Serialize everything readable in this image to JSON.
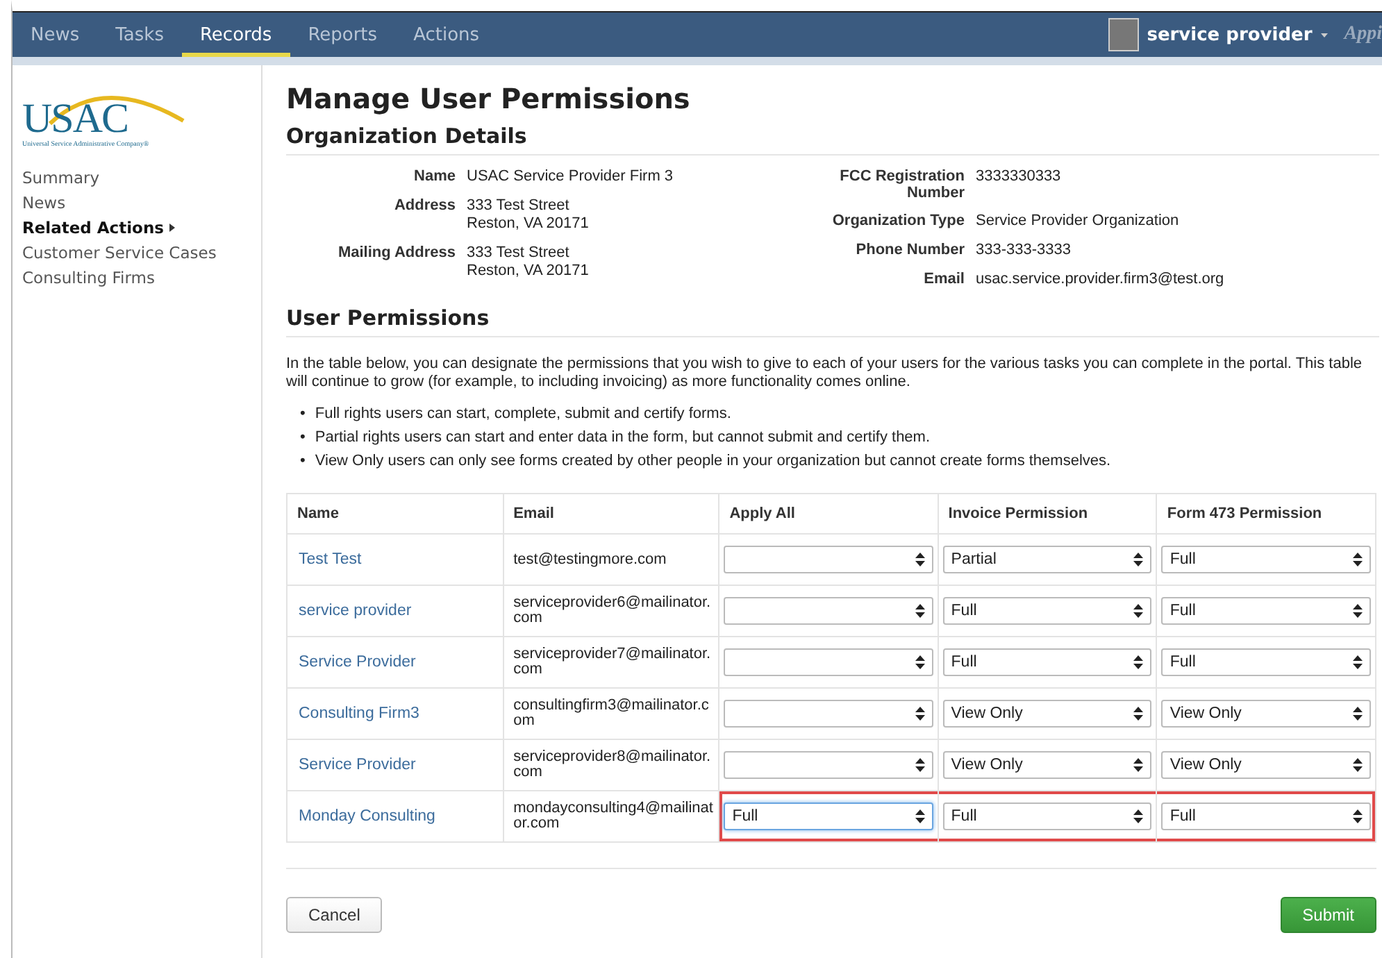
{
  "nav": {
    "tabs": [
      {
        "label": "News",
        "selected": false
      },
      {
        "label": "Tasks",
        "selected": false
      },
      {
        "label": "Records",
        "selected": true
      },
      {
        "label": "Reports",
        "selected": false
      },
      {
        "label": "Actions",
        "selected": false
      }
    ],
    "user": "service provider",
    "brand": "Appi"
  },
  "sidebar": {
    "logo": {
      "text": "USAC",
      "tagline": "Universal Service Administrative Company®"
    },
    "items": [
      {
        "label": "Summary",
        "selected": false,
        "expandable": false
      },
      {
        "label": "News",
        "selected": false,
        "expandable": false
      },
      {
        "label": "Related Actions",
        "selected": true,
        "expandable": true
      },
      {
        "label": "Customer Service Cases",
        "selected": false,
        "expandable": false
      },
      {
        "label": "Consulting Firms",
        "selected": false,
        "expandable": false
      }
    ]
  },
  "page_title": "Manage User Permissions",
  "org_details": {
    "heading": "Organization Details",
    "left": [
      {
        "label": "Name",
        "lines": [
          "USAC Service Provider Firm 3"
        ]
      },
      {
        "label": "Address",
        "lines": [
          "333 Test Street",
          "Reston, VA 20171"
        ]
      },
      {
        "label": "Mailing Address",
        "lines": [
          "333 Test Street",
          "Reston, VA 20171"
        ]
      }
    ],
    "right": [
      {
        "label": "FCC Registration Number",
        "lines": [
          "3333330333"
        ]
      },
      {
        "label": "Organization Type",
        "lines": [
          "Service Provider Organization"
        ]
      },
      {
        "label": "Phone Number",
        "lines": [
          "333-333-3333"
        ]
      },
      {
        "label": "Email",
        "lines": [
          "usac.service.provider.firm3@test.org"
        ]
      }
    ]
  },
  "user_permissions": {
    "heading": "User Permissions",
    "intro": "In the table below, you can designate the permissions that you wish to give to each of your users for the various tasks you can complete in the portal. This table will continue to grow (for example, to including invoicing) as more functionality comes online.",
    "bullets": [
      {
        "marker": "•",
        "text": "Full rights users can start, complete, submit and certify forms."
      },
      {
        "marker": "•",
        "text": "Partial rights users can start and enter data in the form, but cannot submit and certify them."
      },
      {
        "marker": "•",
        "text": "View Only users can only see forms created by other people in your organization but cannot create forms themselves."
      }
    ]
  },
  "table": {
    "columns": [
      "Name",
      "Email",
      "Apply All",
      "Invoice Permission",
      "Form 473 Permission"
    ],
    "rows": [
      {
        "name": "Test Test",
        "email": "test@testingmore.com",
        "apply_all": {
          "focused": false
        },
        "invoice": "Partial",
        "form473": "Full",
        "highlighted": false
      },
      {
        "name": "service provider",
        "email": "serviceprovider6@mailinator.com",
        "apply_all": {
          "focused": false
        },
        "invoice": "Full",
        "form473": "Full",
        "highlighted": false
      },
      {
        "name": "Service Provider",
        "email": "serviceprovider7@mailinator.com",
        "apply_all": {
          "focused": false
        },
        "invoice": "Full",
        "form473": "Full",
        "highlighted": false
      },
      {
        "name": "Consulting Firm3",
        "email": "consultingfirm3@mailinator.com",
        "apply_all": {
          "focused": false
        },
        "invoice": "View Only",
        "form473": "View Only",
        "highlighted": false
      },
      {
        "name": "Service Provider",
        "email": "serviceprovider8@mailinator.com",
        "apply_all": {
          "focused": false
        },
        "invoice": "View Only",
        "form473": "View Only",
        "highlighted": false
      },
      {
        "name": "Monday Consulting",
        "email": "mondayconsulting4@mailinator.com",
        "apply_all": {
          "value": "Full",
          "focused": true
        },
        "invoice": "Full",
        "form473": "Full",
        "highlighted": true
      }
    ]
  },
  "buttons": [
    {
      "label": "Cancel",
      "kind": "secondary"
    },
    {
      "label": "Submit",
      "kind": "primary"
    }
  ]
}
